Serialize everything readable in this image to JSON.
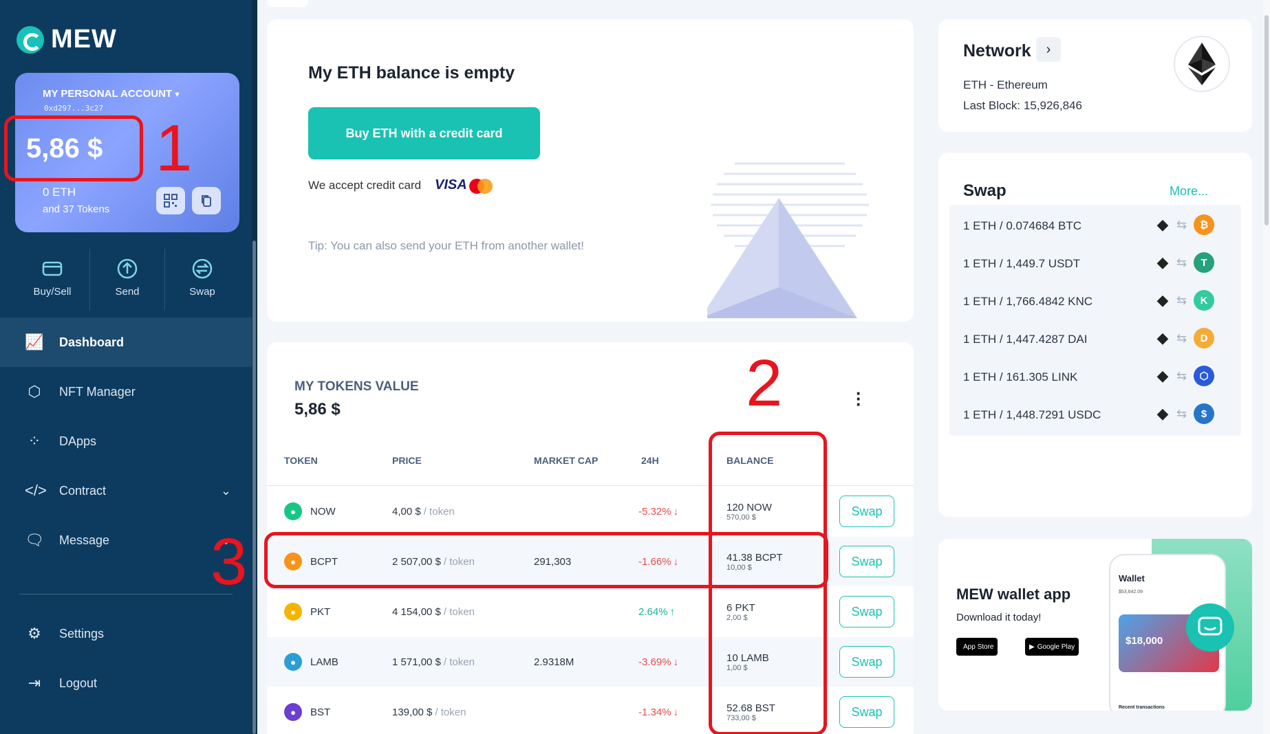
{
  "brand": {
    "name": "MEW"
  },
  "account": {
    "name": "MY PERSONAL ACCOUNT",
    "address": "0xd297...3c27",
    "balance_usd": "5,86 $",
    "eth_balance": "0 ETH",
    "tokens_count": "and 37 Tokens"
  },
  "quick_actions": [
    {
      "label": "Buy/Sell",
      "icon": "card-icon"
    },
    {
      "label": "Send",
      "icon": "send-icon"
    },
    {
      "label": "Swap",
      "icon": "swap-icon"
    }
  ],
  "nav": {
    "dashboard": "Dashboard",
    "nft": "NFT Manager",
    "dapps": "DApps",
    "contract": "Contract",
    "message": "Message",
    "settings": "Settings",
    "logout": "Logout"
  },
  "eth_panel": {
    "title": "My ETH balance is empty",
    "buy_button": "Buy ETH with a credit card",
    "accept_text": "We accept credit card",
    "visa": "VISA",
    "tip": "Tip: You can also send your ETH from another wallet!"
  },
  "tokens": {
    "title": "MY TOKENS VALUE",
    "total": "5,86 $",
    "columns": [
      "TOKEN",
      "PRICE",
      "MARKET CAP",
      "24H",
      "BALANCE"
    ],
    "per_token": "/ token",
    "swap_label": "Swap",
    "rows": [
      {
        "symbol": "NOW",
        "price": "4,00 $",
        "market_cap": "",
        "change": "-5.32%",
        "direction": "down",
        "balance": "120 NOW",
        "balance_usd": "570,00 $",
        "icon_color": "#16c784"
      },
      {
        "symbol": "BCPT",
        "price": "2 507,00 $",
        "market_cap": "291,303",
        "change": "-1.66%",
        "direction": "down",
        "balance": "41.38 BCPT",
        "balance_usd": "10,00 $",
        "icon_color": "#f7931a"
      },
      {
        "symbol": "PKT",
        "price": "4 154,00 $",
        "market_cap": "",
        "change": "2.64%",
        "direction": "up",
        "balance": "6 PKT",
        "balance_usd": "2,00 $",
        "icon_color": "#f5b400"
      },
      {
        "symbol": "LAMB",
        "price": "1 571,00 $",
        "market_cap": "2.9318M",
        "change": "-3.69%",
        "direction": "down",
        "balance": "10 LAMB",
        "balance_usd": "1,00 $",
        "icon_color": "#2a9fd6"
      },
      {
        "symbol": "BST",
        "price": "139,00 $",
        "market_cap": "",
        "change": "-1.34%",
        "direction": "down",
        "balance": "52.68 BST",
        "balance_usd": "733,00 $",
        "icon_color": "#6b3fd1"
      }
    ]
  },
  "network": {
    "title": "Network",
    "name": "ETH - Ethereum",
    "last_block": "Last Block: 15,926,846"
  },
  "swap": {
    "title": "Swap",
    "more": "More...",
    "pairs": [
      {
        "label": "1 ETH / 0.074684 BTC",
        "coin": "btc",
        "color": "#f7931a",
        "glyph": "₿"
      },
      {
        "label": "1 ETH / 1,449.7 USDT",
        "coin": "usdt",
        "color": "#26a17b",
        "glyph": "T"
      },
      {
        "label": "1 ETH / 1,766.4842 KNC",
        "coin": "knc",
        "color": "#31cb9e",
        "glyph": "K"
      },
      {
        "label": "1 ETH / 1,447.4287 DAI",
        "coin": "dai",
        "color": "#f5ac37",
        "glyph": "D"
      },
      {
        "label": "1 ETH / 161.305 LINK",
        "coin": "link",
        "color": "#2a5ada",
        "glyph": "⬡"
      },
      {
        "label": "1 ETH / 1,448.7291 USDC",
        "coin": "usdc",
        "color": "#2775ca",
        "glyph": "$"
      }
    ]
  },
  "app_promo": {
    "title": "MEW wallet app",
    "subtitle": "Download it today!",
    "app_store": "App Store",
    "google_play": "Google Play",
    "phone_wallet": "Wallet",
    "phone_total": "$53,642.09",
    "phone_amount": "$18,000",
    "phone_recent": "Recent transactions"
  },
  "annotations": [
    "1",
    "2",
    "3"
  ]
}
